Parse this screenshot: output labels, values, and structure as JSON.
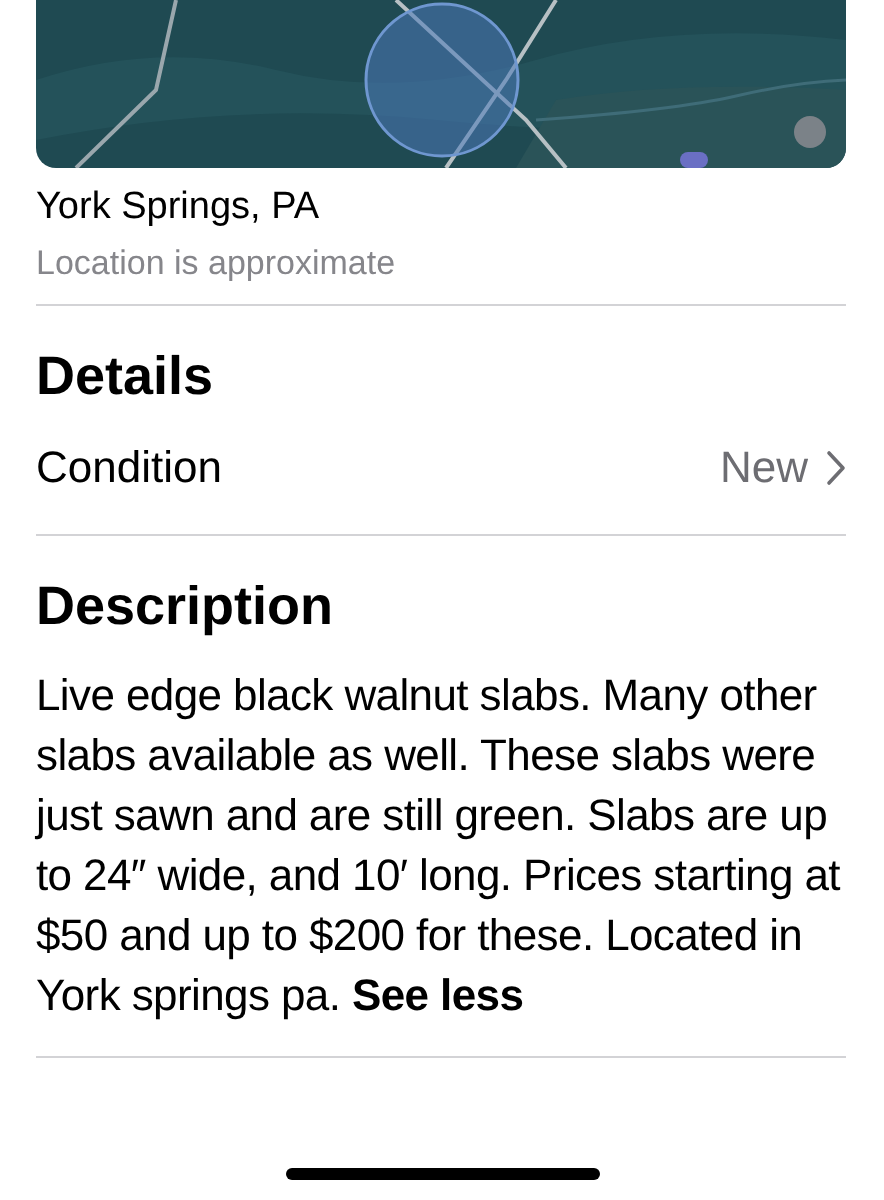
{
  "location": {
    "title": "York Springs, PA",
    "subtitle": "Location is approximate"
  },
  "details": {
    "heading": "Details",
    "rows": [
      {
        "label": "Condition",
        "value": "New"
      }
    ]
  },
  "description": {
    "heading": "Description",
    "text": "Live edge black walnut slabs. Many other slabs available as well. These slabs were just sawn and are still green. Slabs are up to 24″ wide, and 10′ long. Prices starting at $50 and up to $200 for these. Located in York springs pa.",
    "toggle": "See less"
  }
}
